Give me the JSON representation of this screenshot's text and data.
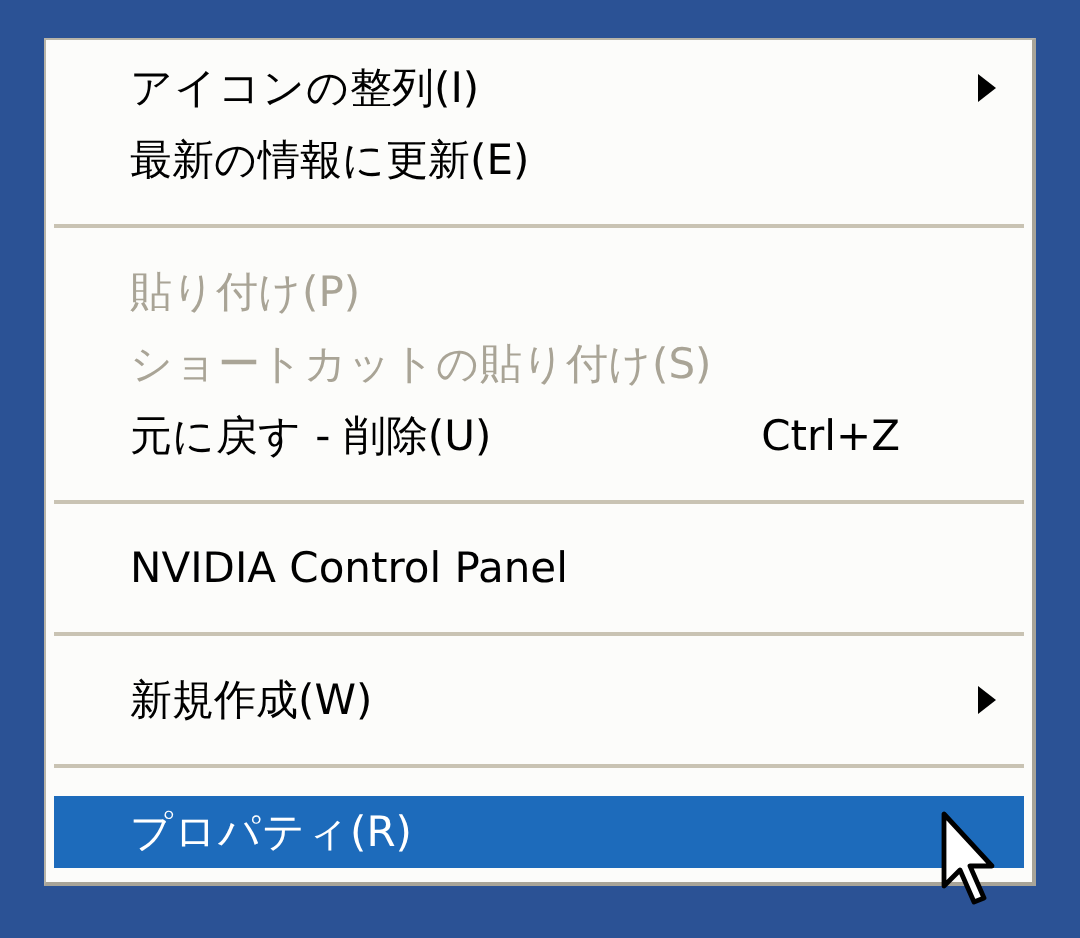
{
  "context_menu": {
    "items": [
      {
        "kind": "item",
        "label": "アイコンの整列(I)",
        "submenu": true,
        "disabled": false,
        "selected": false
      },
      {
        "kind": "item",
        "label": "最新の情報に更新(E)",
        "submenu": false,
        "disabled": false,
        "selected": false
      },
      {
        "kind": "separator"
      },
      {
        "kind": "item",
        "label": "貼り付け(P)",
        "submenu": false,
        "disabled": true,
        "selected": false
      },
      {
        "kind": "item",
        "label": "ショートカットの貼り付け(S)",
        "submenu": false,
        "disabled": true,
        "selected": false
      },
      {
        "kind": "item",
        "label": "元に戻す - 削除(U)",
        "shortcut": "Ctrl+Z",
        "submenu": false,
        "disabled": false,
        "selected": false
      },
      {
        "kind": "separator"
      },
      {
        "kind": "item",
        "label": "NVIDIA Control Panel",
        "submenu": false,
        "disabled": false,
        "selected": false
      },
      {
        "kind": "separator"
      },
      {
        "kind": "item",
        "label": "新規作成(W)",
        "submenu": true,
        "disabled": false,
        "selected": false
      },
      {
        "kind": "separator"
      },
      {
        "kind": "item",
        "label": "プロパティ(R)",
        "submenu": false,
        "disabled": false,
        "selected": true
      }
    ]
  }
}
